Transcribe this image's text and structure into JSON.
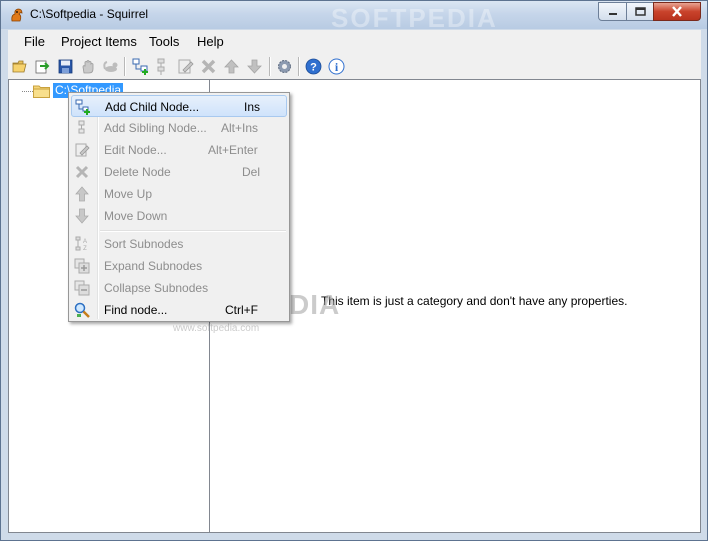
{
  "window": {
    "title": "C:\\Softpedia - Squirrel",
    "watermark_title": "SOFTPEDIA"
  },
  "menubar": {
    "items": [
      {
        "label": "File"
      },
      {
        "label": "Project Items"
      },
      {
        "label": "Tools"
      },
      {
        "label": "Help"
      }
    ]
  },
  "toolbar": {
    "icons": [
      "open-folder-icon",
      "import-icon",
      "save-icon",
      "hand-icon",
      "squirrel-icon",
      "add-child-node-icon",
      "add-sibling-node-icon",
      "edit-node-icon",
      "delete-node-icon",
      "move-up-icon",
      "move-down-icon",
      "settings-icon",
      "help-icon",
      "info-icon"
    ]
  },
  "tree": {
    "root_label": "C:\\Softpedia"
  },
  "properties": {
    "message": "This item is just a category and don't have any properties."
  },
  "context_menu": {
    "items": [
      {
        "label": "Add Child Node...",
        "shortcut": "Ins",
        "enabled": true,
        "icon": "add-child-node-icon"
      },
      {
        "label": "Add Sibling Node...",
        "shortcut": "Alt+Ins",
        "enabled": false,
        "icon": "add-sibling-node-icon"
      },
      {
        "label": "Edit Node...",
        "shortcut": "Alt+Enter",
        "enabled": false,
        "icon": "edit-node-icon"
      },
      {
        "label": "Delete Node",
        "shortcut": "Del",
        "enabled": false,
        "icon": "delete-node-icon"
      },
      {
        "label": "Move Up",
        "shortcut": "",
        "enabled": false,
        "icon": "move-up-icon"
      },
      {
        "label": "Move Down",
        "shortcut": "",
        "enabled": false,
        "icon": "move-down-icon"
      },
      {
        "label": "Sort Subnodes",
        "shortcut": "",
        "enabled": false,
        "icon": "sort-icon"
      },
      {
        "label": "Expand Subnodes",
        "shortcut": "",
        "enabled": false,
        "icon": "expand-icon"
      },
      {
        "label": "Collapse Subnodes",
        "shortcut": "",
        "enabled": false,
        "icon": "collapse-icon"
      },
      {
        "label": "Find node...",
        "shortcut": "Ctrl+F",
        "enabled": true,
        "icon": "find-icon"
      }
    ]
  },
  "watermark": {
    "text": "SOFTPEDIA",
    "url": "www.softpedia.com"
  }
}
